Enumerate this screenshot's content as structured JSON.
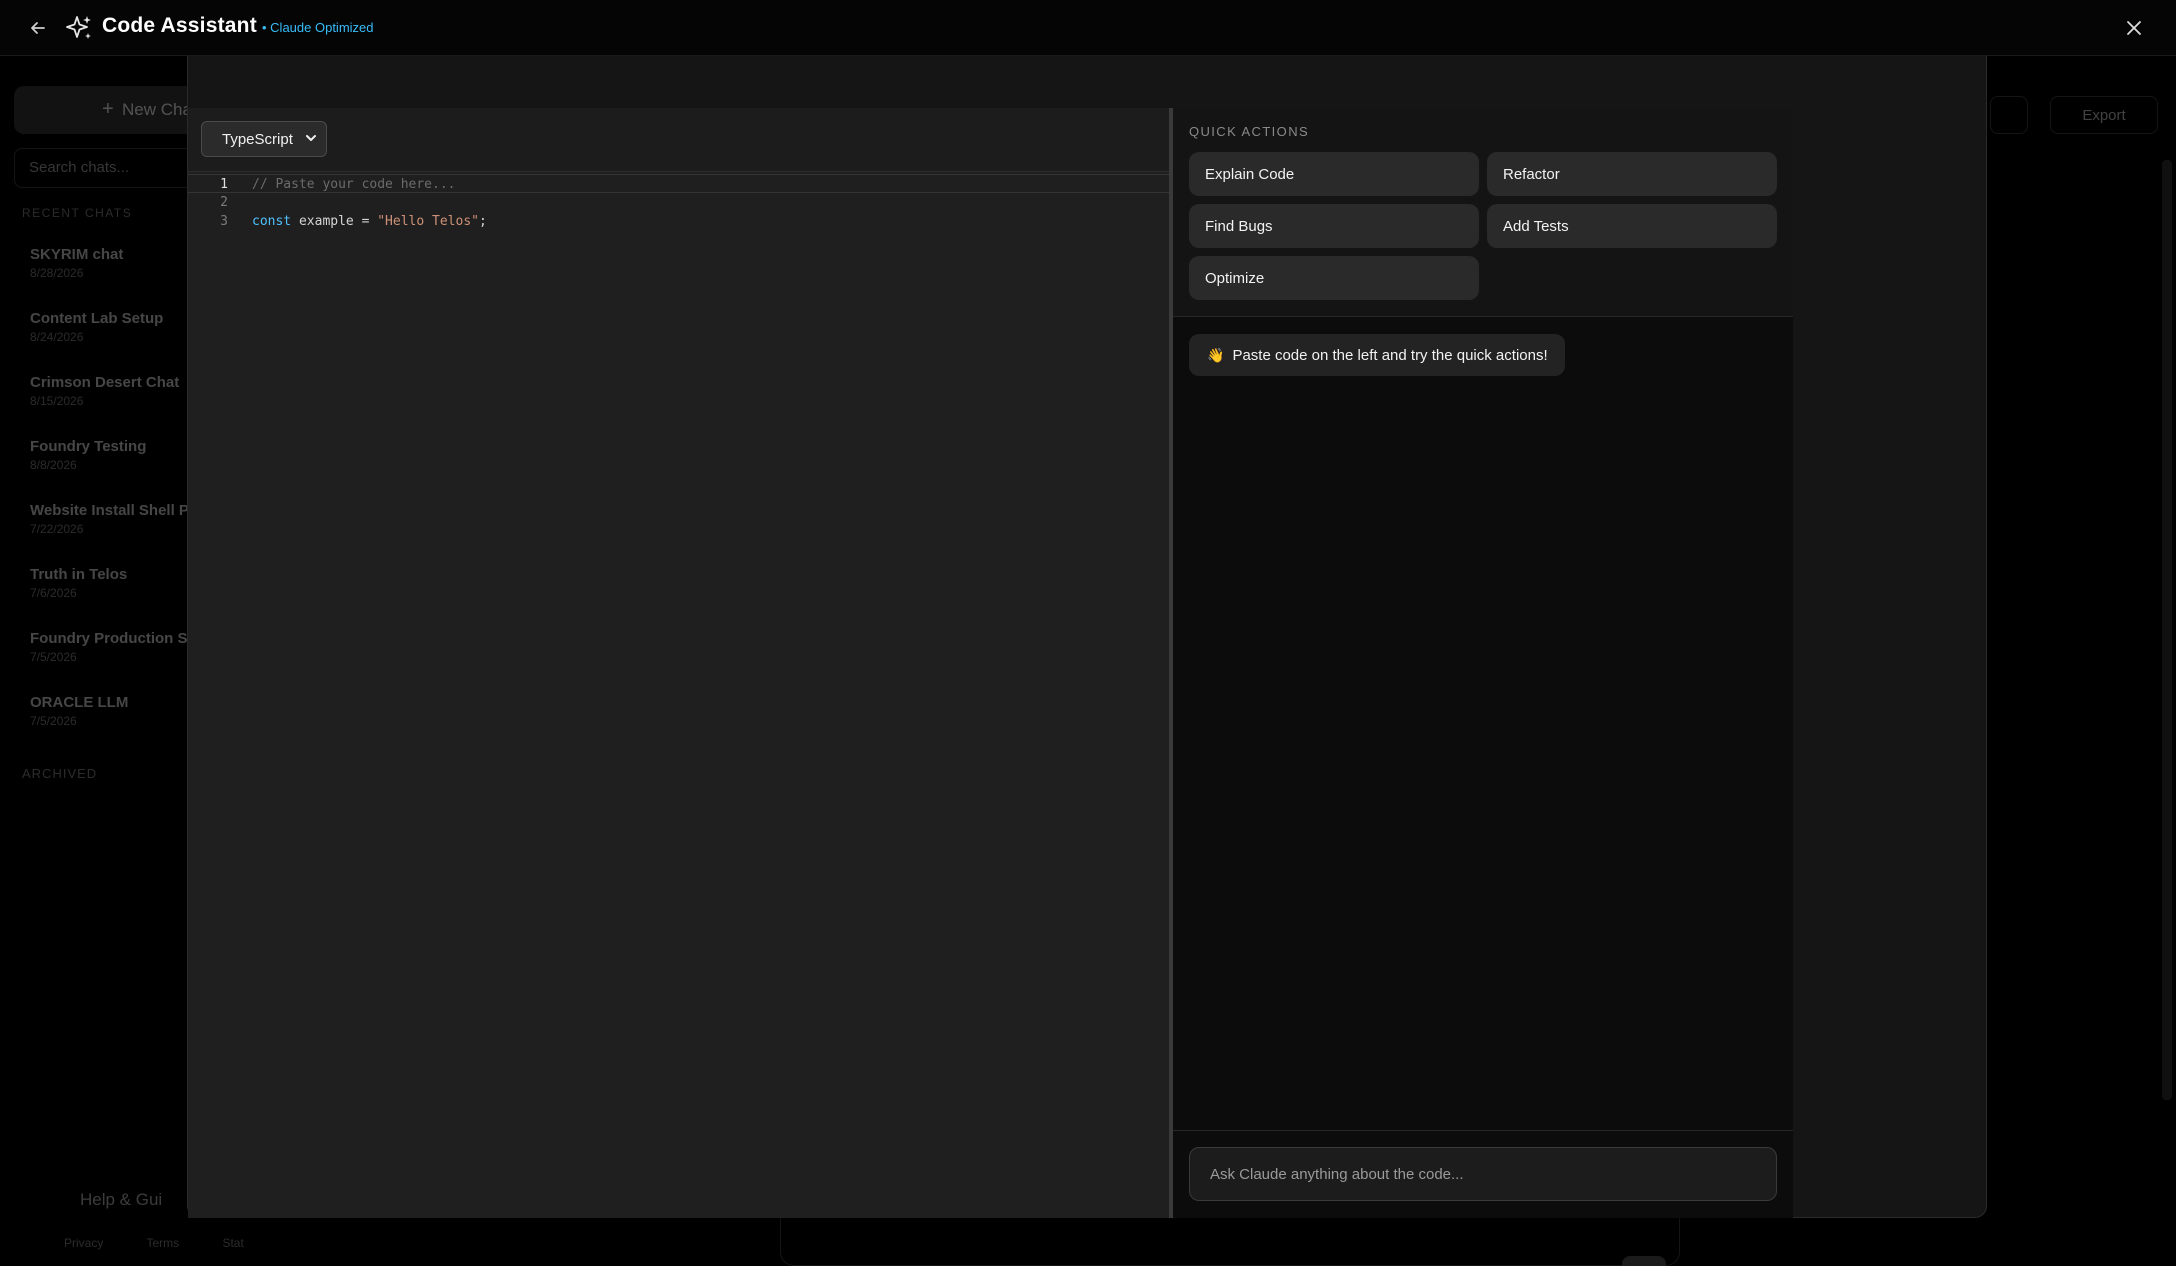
{
  "header": {
    "title": "Code Assistant",
    "badge": "• Claude Optimized",
    "back_icon": "arrow-left-icon",
    "close_icon": "close-icon",
    "logo_icon": "sparkles-icon"
  },
  "background": {
    "new_chat_label": "New Cha",
    "search_placeholder": "Search chats...",
    "recent_label": "RECENT CHATS",
    "chats": [
      {
        "title": "SKYRIM chat",
        "date": "8/28/2026"
      },
      {
        "title": "Content Lab Setup",
        "date": "8/24/2026"
      },
      {
        "title": "Crimson Desert Chat",
        "date": "8/15/2026"
      },
      {
        "title": "Foundry Testing",
        "date": "8/8/2026"
      },
      {
        "title": "Website Install Shell Pla",
        "date": "7/22/2026"
      },
      {
        "title": "Truth in Telos",
        "date": "7/6/2026"
      },
      {
        "title": "Foundry Production Stu",
        "date": "7/5/2026"
      },
      {
        "title": "ORACLE LLM",
        "date": "7/5/2026"
      }
    ],
    "archived_label": "ARCHIVED",
    "help_label": "Help & Gui",
    "footer_links": "Privacy Terms Stat",
    "export_label": "Export"
  },
  "editor": {
    "language": "TypeScript",
    "lines": [
      {
        "num": "1",
        "text": "// Paste your code here..."
      },
      {
        "num": "2",
        "text": ""
      },
      {
        "num": "3",
        "kw": "const",
        "id": " example = ",
        "str": "\"Hello Telos\"",
        "end": ";"
      }
    ]
  },
  "assistant": {
    "quick_actions_label": "QUICK ACTIONS",
    "actions": [
      "Explain Code",
      "Refactor",
      "Find Bugs",
      "Add Tests",
      "Optimize"
    ],
    "hint_emoji": "👋",
    "hint_text": "Paste code on the left and try the quick actions!",
    "ask_placeholder": "Ask Claude anything about the code..."
  },
  "colors": {
    "accent": "#38bdf8",
    "keyword": "#4fc1ff",
    "string": "#ce9178"
  }
}
